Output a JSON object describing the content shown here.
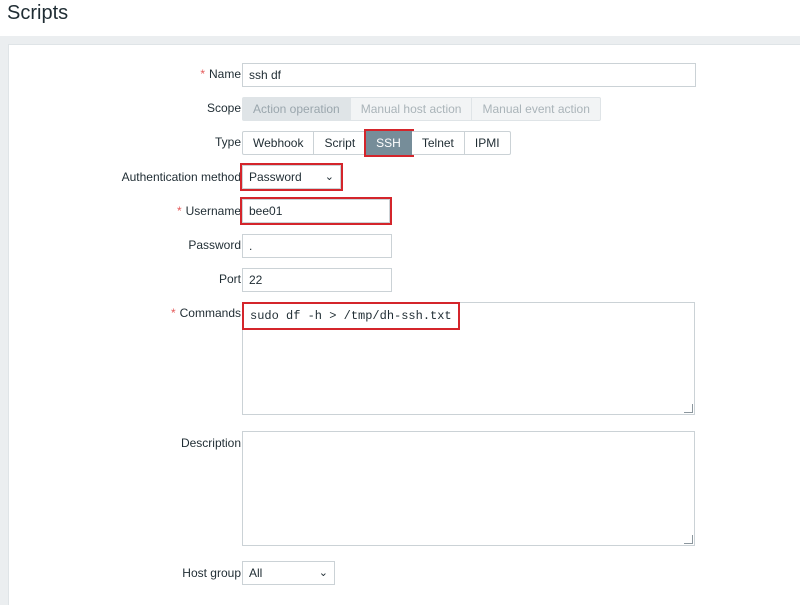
{
  "page": {
    "title": "Scripts"
  },
  "form": {
    "name": {
      "label": "Name",
      "value": "ssh df"
    },
    "scope": {
      "label": "Scope",
      "options": [
        "Action operation",
        "Manual host action",
        "Manual event action"
      ]
    },
    "type": {
      "label": "Type",
      "options": [
        "Webhook",
        "Script",
        "SSH",
        "Telnet",
        "IPMI"
      ],
      "selected": "SSH"
    },
    "auth_method": {
      "label": "Authentication method",
      "value": "Password"
    },
    "username": {
      "label": "Username",
      "value": "bee01"
    },
    "password": {
      "label": "Password",
      "value": "."
    },
    "port": {
      "label": "Port",
      "value": "22"
    },
    "commands": {
      "label": "Commands",
      "value": "sudo df -h > /tmp/dh-ssh.txt"
    },
    "description": {
      "label": "Description",
      "value": ""
    },
    "host_group": {
      "label": "Host group",
      "value": "All"
    },
    "required_mark": "*"
  },
  "colors": {
    "accent": "#768d99",
    "highlight": "#d4252b",
    "required": "#e45959"
  },
  "icons": {
    "dropdown": "chevron-down-icon",
    "resize": "resize-handle-icon"
  }
}
